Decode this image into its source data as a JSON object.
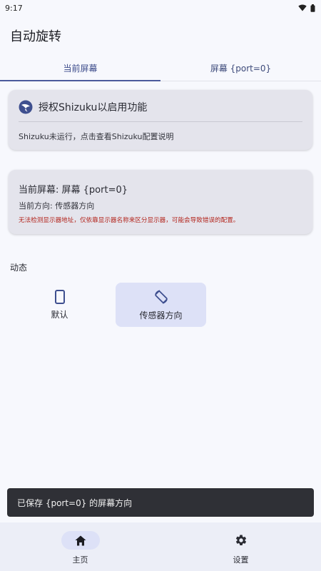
{
  "status_bar": {
    "time": "9:17",
    "icons": [
      "wifi-icon",
      "battery-icon"
    ]
  },
  "app": {
    "title": "自动旋转"
  },
  "tabs": [
    {
      "label": "当前屏幕",
      "active": true
    },
    {
      "label": "屏幕 {port=0}",
      "active": false
    }
  ],
  "auth_card": {
    "icon": "shizuku-icon",
    "title": "授权Shizuku以启用功能",
    "description": "Shizuku未运行，点击查看Shizuku配置说明"
  },
  "screen_card": {
    "title": "当前屏幕: 屏幕 {port=0}",
    "direction": "当前方向: 传感器方向",
    "warning": "无法检测显示器地址，仅依靠显示器名称来区分显示器，可能会导致错误的配置。"
  },
  "section": {
    "label": "动态"
  },
  "options": [
    {
      "label": "默认",
      "icon": "phone-portrait-icon",
      "selected": false
    },
    {
      "label": "传感器方向",
      "icon": "screen-rotation-icon",
      "selected": true
    }
  ],
  "snackbar": {
    "message": "已保存 {port=0} 的屏幕方向"
  },
  "nav": [
    {
      "label": "主页",
      "icon": "home-icon",
      "active": true
    },
    {
      "label": "设置",
      "icon": "gear-icon",
      "active": false
    }
  ],
  "colors": {
    "accent": "#4a5a9c",
    "warning": "#b3261e",
    "selected_bg": "#dde1f7",
    "card_bg": "#e4e4ec"
  }
}
